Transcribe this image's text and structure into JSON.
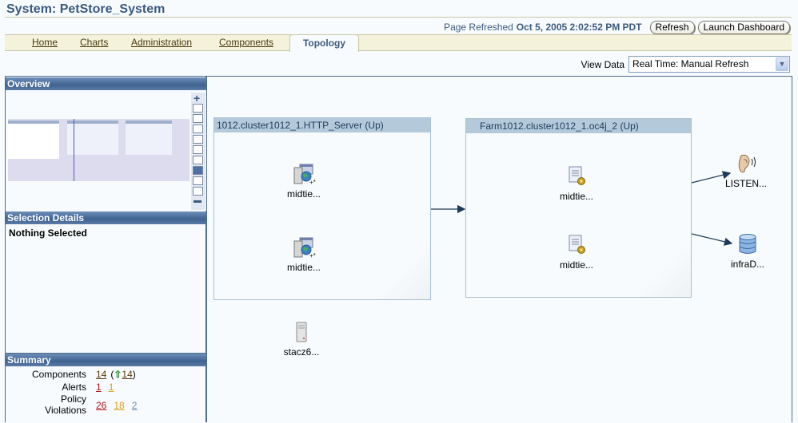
{
  "header": {
    "title": "System: PetStore_System",
    "refresh_label": "Page Refreshed",
    "refresh_time": "Oct 5, 2005 2:02:52 PM PDT",
    "refresh_button": "Refresh",
    "dashboard_button": "Launch Dashboard"
  },
  "tabs": [
    {
      "label": "Home"
    },
    {
      "label": "Charts"
    },
    {
      "label": "Administration"
    },
    {
      "label": "Components"
    },
    {
      "label": "Topology",
      "active": true
    }
  ],
  "view_data": {
    "label": "View Data",
    "selected": "Real Time: Manual Refresh"
  },
  "left_panel": {
    "overview_title": "Overview",
    "zoom_levels": 9,
    "zoom_active_index": 6,
    "selection_title": "Selection Details",
    "selection_text": "Nothing Selected",
    "summary_title": "Summary",
    "summary": {
      "components_label": "Components",
      "components_count": "14",
      "components_up_open": "(",
      "components_up_count": "14",
      "components_up_close": ")",
      "alerts_label": "Alerts",
      "alerts_critical": "1",
      "alerts_warning": "1",
      "policy_label_1": "Policy",
      "policy_label_2": "Violations",
      "policy_critical": "26",
      "policy_warning": "18",
      "policy_info": "2"
    }
  },
  "topology": {
    "groups": [
      {
        "title": "1012.cluster1012_1.HTTP_Server (Up)",
        "nodes": [
          {
            "label": "midtie...",
            "icon": "web-server-icon"
          },
          {
            "label": "midtie...",
            "icon": "web-server-icon"
          }
        ]
      },
      {
        "title": "Farm1012.cluster1012_1.oc4j_2 (Up)",
        "nodes": [
          {
            "label": "midtie...",
            "icon": "application-icon"
          },
          {
            "label": "midtie...",
            "icon": "application-icon"
          }
        ]
      }
    ],
    "standalone": [
      {
        "label": "stacz6...",
        "icon": "host-server-icon"
      },
      {
        "label": "LISTEN...",
        "icon": "listener-ear-icon"
      },
      {
        "label": "infraD...",
        "icon": "database-icon"
      }
    ]
  },
  "colors": {
    "title": "#3b5a80",
    "panel_header": "#3f628f",
    "critical": "#b1141c",
    "warning": "#d9a11b",
    "info": "#6b8db3",
    "up_arrow": "#2e8b2e"
  }
}
